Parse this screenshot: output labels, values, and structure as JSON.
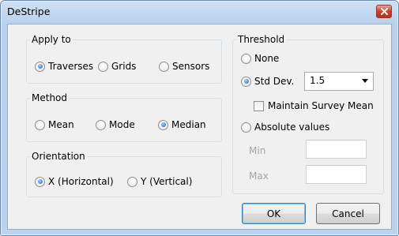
{
  "window": {
    "title": "DeStripe",
    "close_icon": "close-icon"
  },
  "apply_to": {
    "label": "Apply to",
    "options": [
      {
        "label": "Traverses",
        "selected": true
      },
      {
        "label": "Grids",
        "selected": false
      },
      {
        "label": "Sensors",
        "selected": false
      }
    ]
  },
  "method": {
    "label": "Method",
    "options": [
      {
        "label": "Mean",
        "selected": false
      },
      {
        "label": "Mode",
        "selected": false
      },
      {
        "label": "Median",
        "selected": true
      }
    ]
  },
  "orientation": {
    "label": "Orientation",
    "options": [
      {
        "label": "X (Horizontal)",
        "selected": true
      },
      {
        "label": "Y (Vertical)",
        "selected": false
      }
    ]
  },
  "threshold": {
    "label": "Threshold",
    "none_label": "None",
    "std_dev_label": "Std Dev.",
    "std_dev_value": "1.5",
    "maintain_label": "Maintain Survey Mean",
    "maintain_checked": false,
    "absolute_label": "Absolute values",
    "min_label": "Min",
    "min_value": "",
    "max_label": "Max",
    "max_value": "",
    "selected": "std_dev"
  },
  "buttons": {
    "ok": "OK",
    "cancel": "Cancel"
  }
}
